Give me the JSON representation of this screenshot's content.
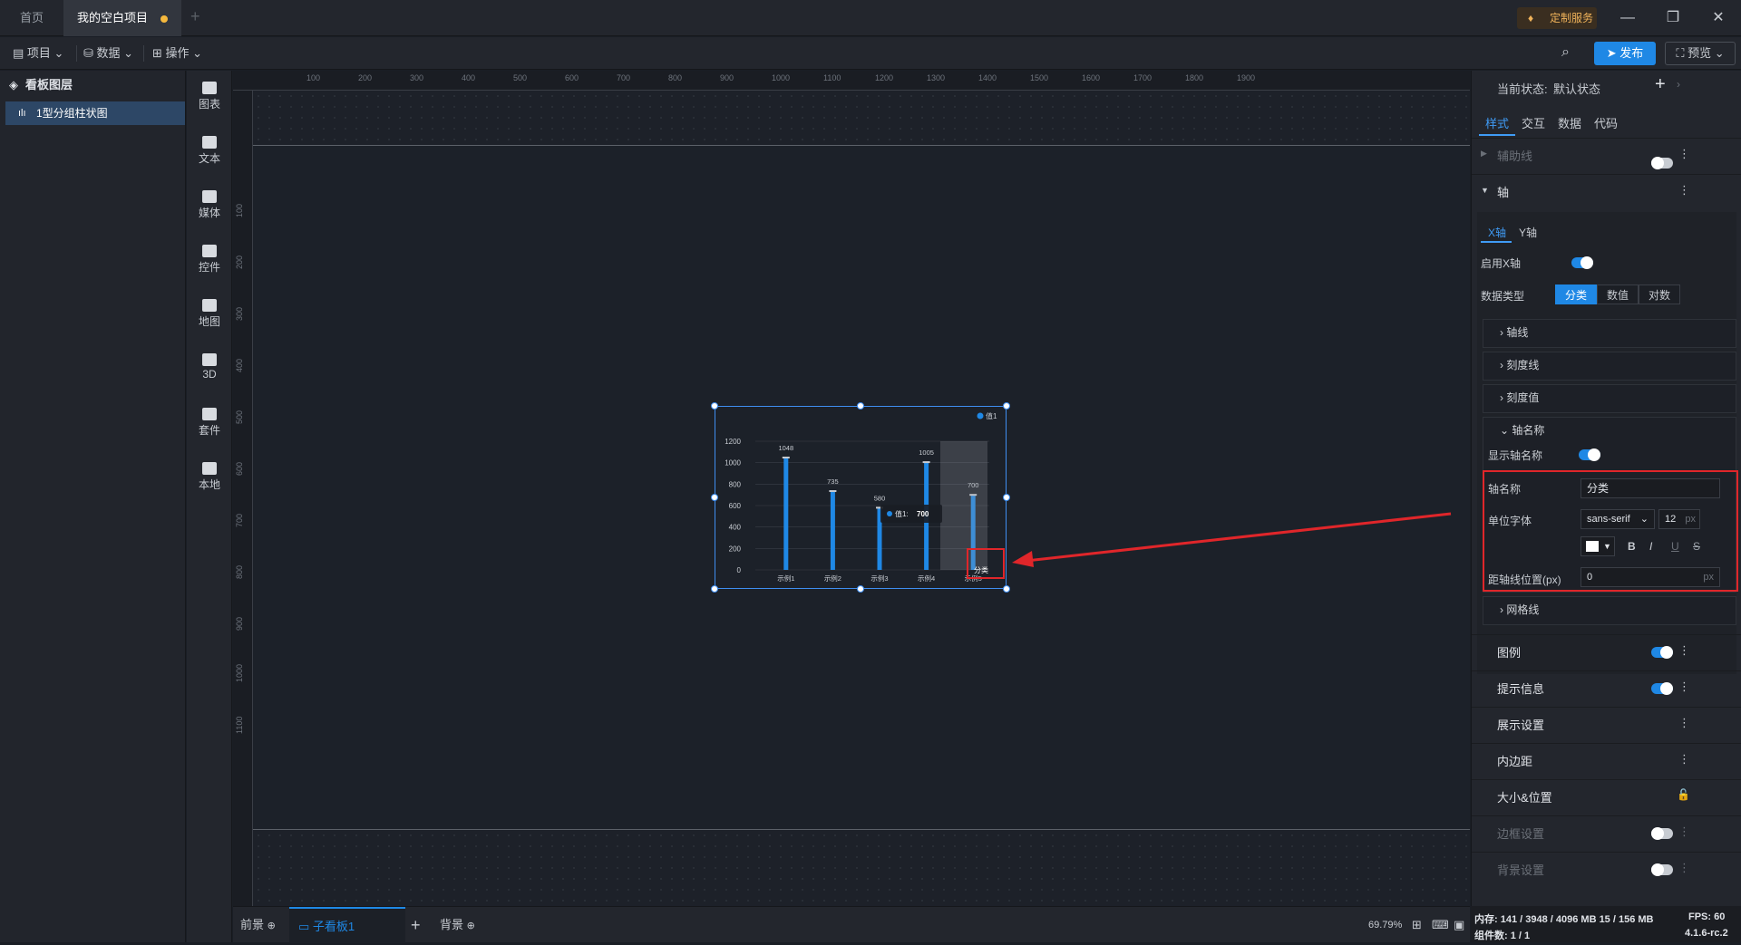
{
  "titlebar": {
    "tab_home": "首页",
    "tab_project": "我的空白项目",
    "custom_service": "定制服务"
  },
  "menubar": {
    "project": "项目",
    "data": "数据",
    "ops": "操作",
    "publish": "发布",
    "preview": "预览"
  },
  "layers": {
    "title": "看板图层",
    "item": "1型分组柱状图"
  },
  "tools": [
    "图表",
    "文本",
    "媒体",
    "控件",
    "地图",
    "3D",
    "套件",
    "本地"
  ],
  "ruler": {
    "top": [
      "100",
      "200",
      "300",
      "400",
      "500",
      "600",
      "700",
      "800",
      "900",
      "1000",
      "1100",
      "1200",
      "1300",
      "1400",
      "1500",
      "1600",
      "1700",
      "1800",
      "1900"
    ],
    "left": [
      "100",
      "200",
      "300",
      "400",
      "500",
      "600",
      "700",
      "800",
      "900",
      "1000",
      "1100"
    ]
  },
  "chart_data": {
    "type": "bar",
    "categories": [
      "示例1",
      "示例2",
      "示例3",
      "示例4",
      "示例5"
    ],
    "series": [
      {
        "name": "值1",
        "values": [
          1048,
          735,
          580,
          1005,
          700
        ]
      }
    ],
    "ylim": [
      0,
      1200
    ],
    "yticks": [
      "1200",
      "1000",
      "800",
      "600",
      "400",
      "200",
      "0"
    ],
    "xlabel": "分类",
    "tooltip_label": "值1:",
    "tooltip_value": "700",
    "legend": "值1",
    "color": "#1f88e5"
  },
  "bottom": {
    "front": "前景",
    "subboard": "子看板1",
    "back": "背景",
    "zoom": "69.79%"
  },
  "right": {
    "state_label": "当前状态:",
    "state_value": "默认状态",
    "tabs": [
      "样式",
      "交互",
      "数据",
      "代码"
    ],
    "sec_aux": "辅助线",
    "sec_axis": "轴",
    "axis_tabs": [
      "X轴",
      "Y轴"
    ],
    "enable_x": "启用X轴",
    "data_type": "数据类型",
    "types": [
      "分类",
      "数值",
      "对数"
    ],
    "sub_axisline": "轴线",
    "sub_tick": "刻度线",
    "sub_tickval": "刻度值",
    "sub_axisname": "轴名称",
    "show_axisname": "显示轴名称",
    "axisname_label": "轴名称",
    "axisname_value": "分类",
    "font_label": "单位字体",
    "font_value": "sans-serif",
    "font_size": "12",
    "px": "px",
    "offset_label": "距轴线位置(px)",
    "offset_value": "0",
    "sub_grid": "网格线",
    "sec_legend": "图例",
    "sec_tooltip": "提示信息",
    "sec_display": "展示设置",
    "sec_padding": "内边距",
    "sec_size": "大小&位置",
    "sec_border": "边框设置",
    "sec_bg": "背景设置"
  },
  "status": {
    "mem": "内存: 141 / 3948 / 4096 MB 15 / 156 MB",
    "fps": "FPS: 60",
    "count": "组件数: 1 / 1",
    "version": "4.1.6-rc.2"
  }
}
